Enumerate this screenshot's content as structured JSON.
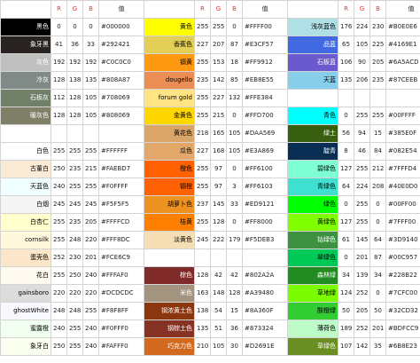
{
  "header": [
    "",
    "R",
    "G",
    "B",
    "值"
  ],
  "groups": [
    {
      "rows": [
        {
          "name": "黑色",
          "r": "0",
          "g": "0",
          "b": "0",
          "hex": "#000000",
          "bg": "#000000",
          "fg": "#ffffff"
        },
        {
          "name": "象牙黑",
          "r": "41",
          "g": "36",
          "b": "33",
          "hex": "#292421",
          "bg": "#292421",
          "fg": "#ffffff"
        },
        {
          "name": "灰色",
          "r": "192",
          "g": "192",
          "b": "192",
          "hex": "#C0C0C0",
          "bg": "#c0c0c0",
          "fg": "#ffffff"
        },
        {
          "name": "冷灰",
          "r": "128",
          "g": "138",
          "b": "135",
          "hex": "#808A87",
          "bg": "#808a87",
          "fg": "#ffffff"
        },
        {
          "name": "石板灰",
          "r": "112",
          "g": "128",
          "b": "105",
          "hex": "#708069",
          "bg": "#708069",
          "fg": "#ffffff"
        },
        {
          "name": "暖灰色",
          "r": "128",
          "g": "128",
          "b": "105",
          "hex": "#808069",
          "bg": "#808069",
          "fg": "#ffffff"
        },
        {
          "name": "",
          "r": "",
          "g": "",
          "b": "",
          "hex": "",
          "bg": "#ffffff",
          "fg": "#000000"
        },
        {
          "name": "白色",
          "r": "255",
          "g": "255",
          "b": "255",
          "hex": "#FFFFFF",
          "bg": "#ffffff",
          "fg": "#000000"
        },
        {
          "name": "古董白",
          "r": "250",
          "g": "235",
          "b": "215",
          "hex": "#FAEBD7",
          "bg": "#faebd7",
          "fg": "#000000"
        },
        {
          "name": "天蓝色",
          "r": "240",
          "g": "255",
          "b": "255",
          "hex": "#F0FFFF",
          "bg": "#f0ffff",
          "fg": "#000000"
        },
        {
          "name": "白烟",
          "r": "245",
          "g": "245",
          "b": "245",
          "hex": "#F5F5F5",
          "bg": "#f5f5f5",
          "fg": "#000000"
        },
        {
          "name": "白杏仁",
          "r": "255",
          "g": "235",
          "b": "205",
          "hex": "#FFFFCD",
          "bg": "#ffffcd",
          "fg": "#000000"
        },
        {
          "name": "cornsilk",
          "r": "255",
          "g": "248",
          "b": "220",
          "hex": "#FFF8DC",
          "bg": "#fff8dc",
          "fg": "#000000"
        },
        {
          "name": "蛋壳色",
          "r": "252",
          "g": "230",
          "b": "201",
          "hex": "#FCE6C9",
          "bg": "#fce6c9",
          "fg": "#000000"
        },
        {
          "name": "花白",
          "r": "255",
          "g": "250",
          "b": "240",
          "hex": "#FFFAF0",
          "bg": "#fffaf0",
          "fg": "#000000"
        },
        {
          "name": "gainsboro",
          "r": "220",
          "g": "220",
          "b": "220",
          "hex": "#DCDCDC",
          "bg": "#dcdcdc",
          "fg": "#000000"
        },
        {
          "name": "ghostWhite",
          "r": "248",
          "g": "248",
          "b": "255",
          "hex": "#F8F8FF",
          "bg": "#f8f8ff",
          "fg": "#000000"
        },
        {
          "name": "蜜露橙",
          "r": "240",
          "g": "255",
          "b": "240",
          "hex": "#F0FFF0",
          "bg": "#f0fff0",
          "fg": "#000000"
        },
        {
          "name": "象牙白",
          "r": "250",
          "g": "255",
          "b": "240",
          "hex": "#FAFFF0",
          "bg": "#fafff0",
          "fg": "#000000"
        }
      ]
    },
    {
      "rows": [
        {
          "name": "黄色",
          "r": "255",
          "g": "255",
          "b": "0",
          "hex": "#FFFF00",
          "bg": "#ffff00",
          "fg": "#000000"
        },
        {
          "name": "香蕉色",
          "r": "227",
          "g": "207",
          "b": "87",
          "hex": "#E3CF57",
          "bg": "#e3cf57",
          "fg": "#000000"
        },
        {
          "name": "镉黄",
          "r": "255",
          "g": "153",
          "b": "18",
          "hex": "#FF9912",
          "bg": "#ff9912",
          "fg": "#000000"
        },
        {
          "name": "dougello",
          "r": "235",
          "g": "142",
          "b": "85",
          "hex": "#EB8E55",
          "bg": "#eb8e55",
          "fg": "#000000"
        },
        {
          "name": "forum gold",
          "r": "255",
          "g": "227",
          "b": "132",
          "hex": "#FFE384",
          "bg": "#ffe384",
          "fg": "#000000"
        },
        {
          "name": "金黄色",
          "r": "255",
          "g": "215",
          "b": "0",
          "hex": "#FFD700",
          "bg": "#ffd700",
          "fg": "#000000"
        },
        {
          "name": "黄花色",
          "r": "218",
          "g": "165",
          "b": "105",
          "hex": "#DAA569",
          "bg": "#daa569",
          "fg": "#000000"
        },
        {
          "name": "瓜色",
          "r": "227",
          "g": "168",
          "b": "105",
          "hex": "#E3A869",
          "bg": "#e3a869",
          "fg": "#000000"
        },
        {
          "name": "橙色",
          "r": "255",
          "g": "97",
          "b": "0",
          "hex": "#FF6100",
          "bg": "#ff6100",
          "fg": "#000000"
        },
        {
          "name": "镉橙",
          "r": "255",
          "g": "97",
          "b": "3",
          "hex": "#FF6103",
          "bg": "#ff6103",
          "fg": "#000000"
        },
        {
          "name": "胡萝卜色",
          "r": "237",
          "g": "145",
          "b": "33",
          "hex": "#ED9121",
          "bg": "#ed9121",
          "fg": "#000000"
        },
        {
          "name": "桔黄",
          "r": "255",
          "g": "128",
          "b": "0",
          "hex": "#FF8000",
          "bg": "#ff8000",
          "fg": "#000000"
        },
        {
          "name": "淡黄色",
          "r": "245",
          "g": "222",
          "b": "179",
          "hex": "#F5DEB3",
          "bg": "#f5deb3",
          "fg": "#000000"
        },
        {
          "name": "",
          "r": "",
          "g": "",
          "b": "",
          "hex": "",
          "bg": "#ffffff",
          "fg": "#000000"
        },
        {
          "name": "棕色",
          "r": "128",
          "g": "42",
          "b": "42",
          "hex": "#802A2A",
          "bg": "#802a2a",
          "fg": "#ffffff"
        },
        {
          "name": "米色",
          "r": "163",
          "g": "148",
          "b": "128",
          "hex": "#A39480",
          "bg": "#a39480",
          "fg": "#ffffff"
        },
        {
          "name": "钢浓黄土色",
          "r": "138",
          "g": "54",
          "b": "15",
          "hex": "#8A360F",
          "bg": "#8a360f",
          "fg": "#ffffff"
        },
        {
          "name": "钢棕土色",
          "r": "135",
          "g": "51",
          "b": "36",
          "hex": "#873324",
          "bg": "#873324",
          "fg": "#ffffff"
        },
        {
          "name": "巧克力色",
          "r": "210",
          "g": "105",
          "b": "30",
          "hex": "#D2691E",
          "bg": "#d2691e",
          "fg": "#ffffff"
        }
      ]
    },
    {
      "rows": [
        {
          "name": "浅灰蓝色",
          "r": "176",
          "g": "224",
          "b": "230",
          "hex": "#B0E0E6",
          "bg": "#b0e0e6",
          "fg": "#000000"
        },
        {
          "name": "品蓝",
          "r": "65",
          "g": "105",
          "b": "225",
          "hex": "#4169E1",
          "bg": "#4169e1",
          "fg": "#ffffff"
        },
        {
          "name": "石板蓝",
          "r": "106",
          "g": "90",
          "b": "205",
          "hex": "#6A5ACD",
          "bg": "#6a5acd",
          "fg": "#ffffff"
        },
        {
          "name": "天蓝",
          "r": "135",
          "g": "206",
          "b": "235",
          "hex": "#87CEEB",
          "bg": "#87ceeb",
          "fg": "#000000"
        },
        {
          "name": "",
          "r": "",
          "g": "",
          "b": "",
          "hex": "",
          "bg": "#ffffff",
          "fg": "#000000"
        },
        {
          "name": "青色",
          "r": "0",
          "g": "255",
          "b": "255",
          "hex": "#00FFFF",
          "bg": "#00ffff",
          "fg": "#000000"
        },
        {
          "name": "绿土",
          "r": "56",
          "g": "94",
          "b": "15",
          "hex": "#385E0F",
          "bg": "#385e0f",
          "fg": "#ffffff"
        },
        {
          "name": "靛青",
          "r": "8",
          "g": "46",
          "b": "84",
          "hex": "#082E54",
          "bg": "#082e54",
          "fg": "#ffffff"
        },
        {
          "name": "碧绿色",
          "r": "127",
          "g": "255",
          "b": "212",
          "hex": "#7FFFD4",
          "bg": "#7fffd4",
          "fg": "#000000"
        },
        {
          "name": "青绿色",
          "r": "64",
          "g": "224",
          "b": "208",
          "hex": "#40E0D0",
          "bg": "#40e0d0",
          "fg": "#000000"
        },
        {
          "name": "绿色",
          "r": "0",
          "g": "255",
          "b": "0",
          "hex": "#00FF00",
          "bg": "#00ff00",
          "fg": "#000000"
        },
        {
          "name": "黄绿色",
          "r": "127",
          "g": "255",
          "b": "0",
          "hex": "#7FFF00",
          "bg": "#7fff00",
          "fg": "#000000"
        },
        {
          "name": "钴绿色",
          "r": "61",
          "g": "145",
          "b": "64",
          "hex": "#3D9140",
          "bg": "#3d9140",
          "fg": "#ffffff"
        },
        {
          "name": "翠绿色",
          "r": "0",
          "g": "201",
          "b": "87",
          "hex": "#00C957",
          "bg": "#00c957",
          "fg": "#000000"
        },
        {
          "name": "森林绿",
          "r": "34",
          "g": "139",
          "b": "34",
          "hex": "#228B22",
          "bg": "#228b22",
          "fg": "#ffffff"
        },
        {
          "name": "草地绿",
          "r": "124",
          "g": "252",
          "b": "0",
          "hex": "#7CFC00",
          "bg": "#7cfc00",
          "fg": "#000000"
        },
        {
          "name": "酸橙绿",
          "r": "50",
          "g": "205",
          "b": "50",
          "hex": "#32CD32",
          "bg": "#32cd32",
          "fg": "#000000"
        },
        {
          "name": "薄荷色",
          "r": "189",
          "g": "252",
          "b": "201",
          "hex": "#BDFCC9",
          "bg": "#bdfcc9",
          "fg": "#000000"
        },
        {
          "name": "草绿色",
          "r": "107",
          "g": "142",
          "b": "35",
          "hex": "#6B8E23",
          "bg": "#6b8e23",
          "fg": "#ffffff"
        }
      ]
    }
  ]
}
